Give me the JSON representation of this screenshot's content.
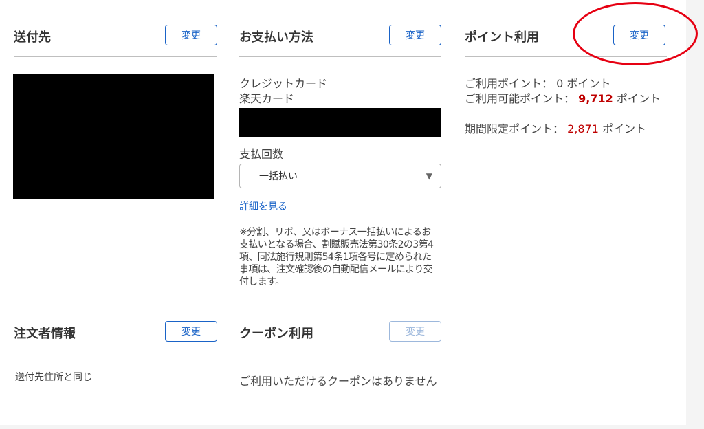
{
  "shipping": {
    "title": "送付先",
    "change_label": "変更"
  },
  "payment": {
    "title": "お支払い方法",
    "change_label": "変更",
    "method_line1": "クレジットカード",
    "method_line2": "楽天カード",
    "installments_label": "支払回数",
    "installments_value": "一括払い",
    "details_link": "詳細を見る",
    "notice": "※分割、リボ、又はボーナス一括払いによるお支払いとなる場合、割賦販売法第30条2の3第4項、同法施行規則第54条1項各号に定められた事項は、注文確認後の自動配信メールにより交付します。"
  },
  "points": {
    "title": "ポイント利用",
    "change_label": "変更",
    "used_label": "ご利用ポイント：",
    "used_value": "0",
    "unit": "ポイント",
    "available_label": "ご利用可能ポイント：",
    "available_value": "9,712",
    "limited_label": "期間限定ポイント：",
    "limited_value": "2,871"
  },
  "orderer": {
    "title": "注文者情報",
    "change_label": "変更",
    "info": "送付先住所と同じ"
  },
  "coupon": {
    "title": "クーポン利用",
    "change_label": "変更",
    "info": "ご利用いただけるクーポンはありません"
  },
  "colors": {
    "accent_blue": "#1a63c7",
    "point_red": "#bf0000",
    "annotation_red": "#e60012"
  }
}
